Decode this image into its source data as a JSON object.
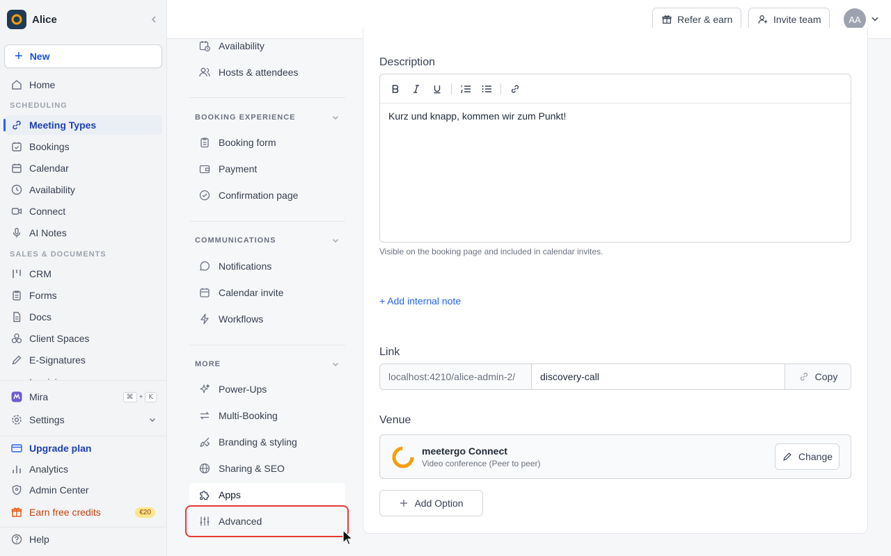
{
  "workspace": {
    "name": "Alice"
  },
  "sidebar": {
    "new_label": "New",
    "home": "Home",
    "scheduling_header": "SCHEDULING",
    "scheduling": [
      "Meeting Types",
      "Bookings",
      "Calendar",
      "Availability",
      "Connect",
      "AI Notes"
    ],
    "sales_header": "SALES & DOCUMENTS",
    "sales": [
      "CRM",
      "Forms",
      "Docs",
      "Client Spaces",
      "E-Signatures",
      "Invoicing"
    ],
    "mira": "Mira",
    "mira_shortcut": [
      "⌘",
      "+",
      "K"
    ],
    "settings": "Settings",
    "upgrade": "Upgrade plan",
    "analytics": "Analytics",
    "admin_center": "Admin Center",
    "earn_credits": "Earn free credits",
    "earn_badge": "€20",
    "help": "Help"
  },
  "header": {
    "refer": "Refer & earn",
    "invite": "Invite team",
    "avatar": "AA"
  },
  "subnav": {
    "top_items": [
      "Availability",
      "Hosts & attendees"
    ],
    "booking_header": "BOOKING EXPERIENCE",
    "booking_items": [
      "Booking form",
      "Payment",
      "Confirmation page"
    ],
    "comm_header": "COMMUNICATIONS",
    "comm_items": [
      "Notifications",
      "Calendar invite",
      "Workflows"
    ],
    "more_header": "MORE",
    "more_items": [
      "Power-Ups",
      "Multi-Booking",
      "Branding & styling",
      "Sharing & SEO",
      "Apps",
      "Advanced"
    ]
  },
  "main": {
    "description_label": "Description",
    "description_text": "Kurz und knapp, kommen wir zum Punkt!",
    "description_hint": "Visible on the booking page and included in calendar invites.",
    "add_note": "+ Add internal note",
    "link_label": "Link",
    "link_prefix": "localhost:4210/alice-admin-2/",
    "link_slug": "discovery-call",
    "copy": "Copy",
    "venue_label": "Venue",
    "venue_name": "meetergo Connect",
    "venue_sub": "Video conference (Peer to peer)",
    "change": "Change",
    "add_option": "Add Option"
  },
  "colors": {
    "accent": "#2563eb",
    "highlight_box": "#e53935",
    "earn": "#c2410c"
  }
}
